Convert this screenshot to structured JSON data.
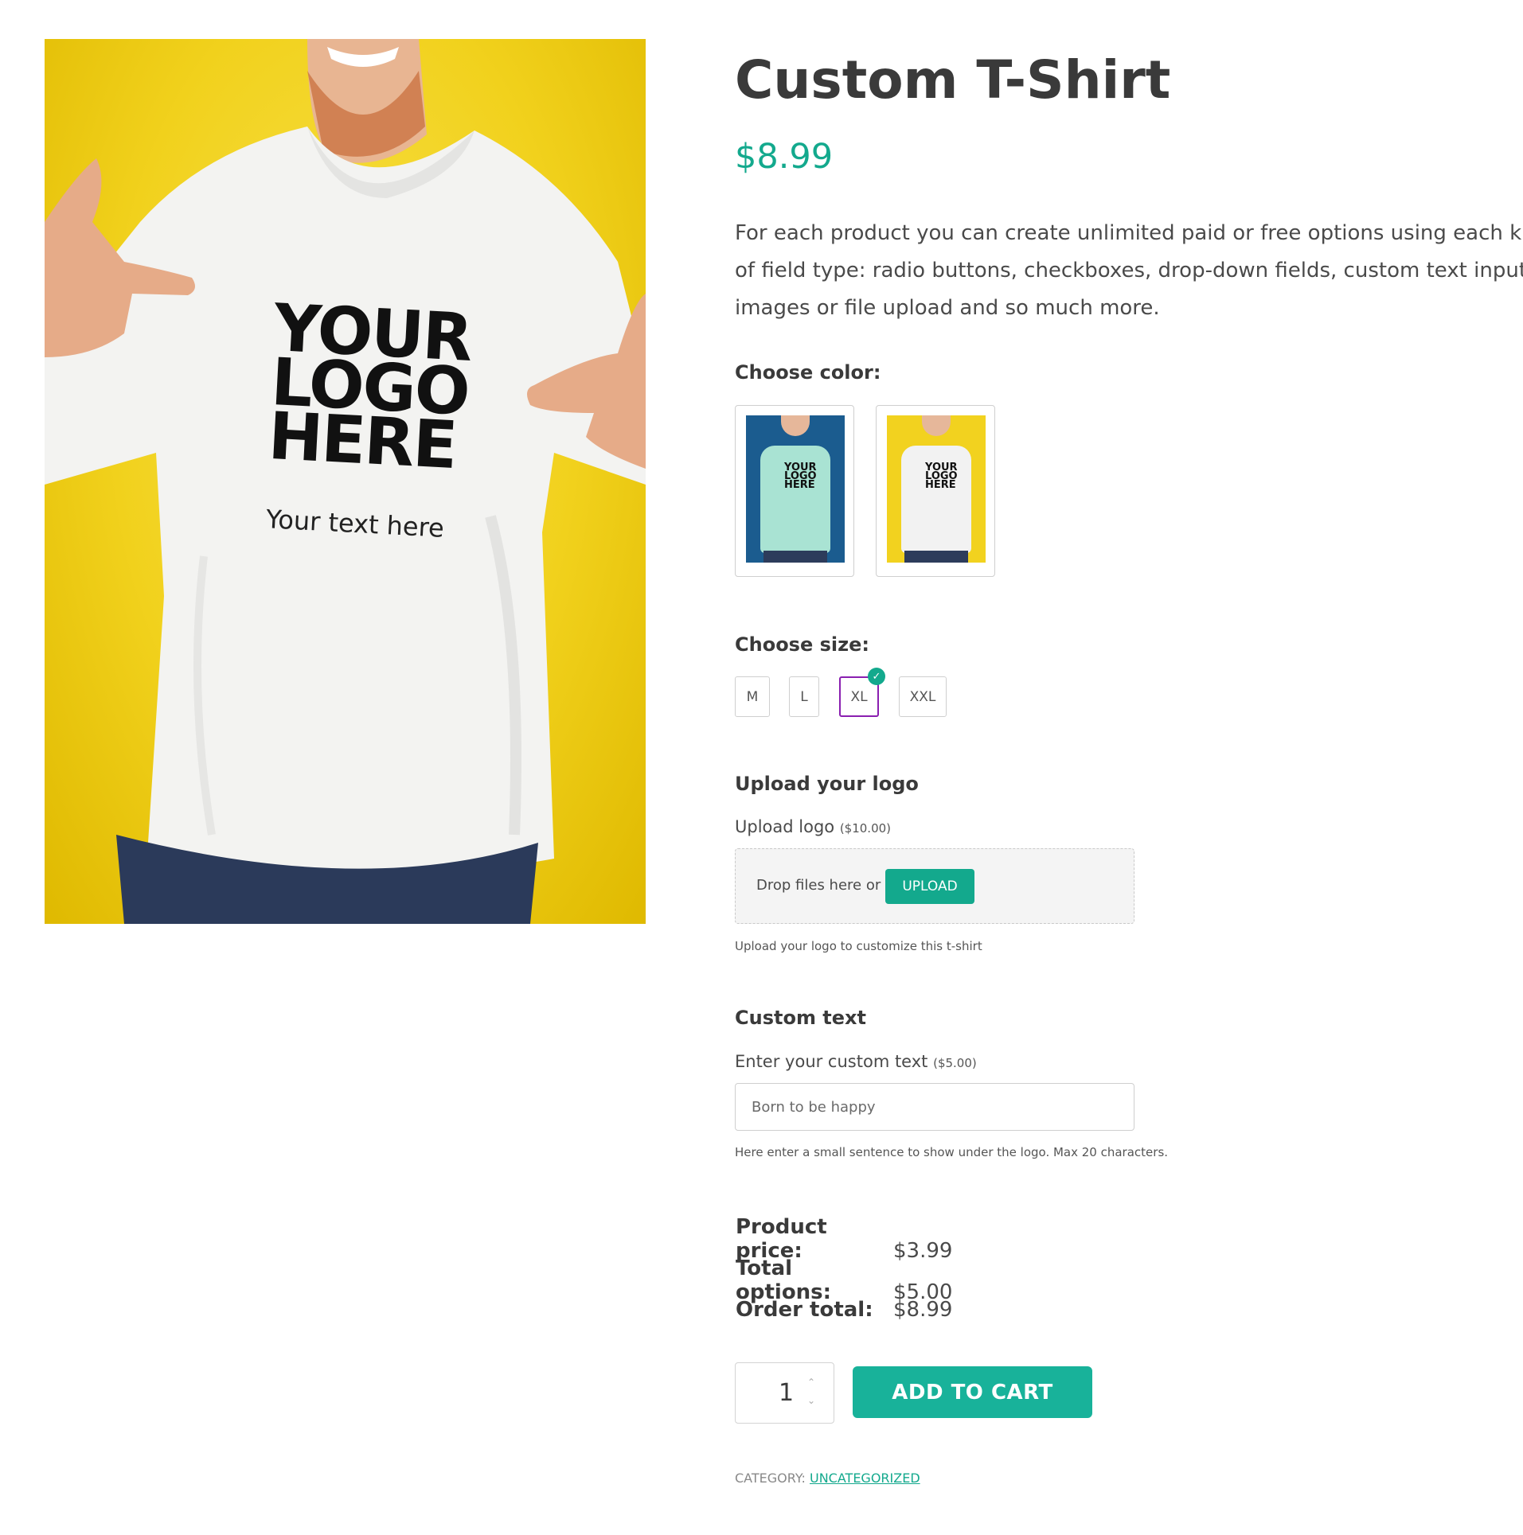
{
  "hero": {
    "logo_lines": [
      "YOUR",
      "LOGO",
      "HERE"
    ],
    "shirt_text": "Your text here"
  },
  "product": {
    "title": "Custom T-Shirt",
    "price": "$8.99",
    "description": "For each product you can create unlimited paid or free options using each kind of field type: radio buttons, checkboxes, drop-down fields, custom text inputs, images or file upload and so much more."
  },
  "color": {
    "label": "Choose color:",
    "swatches": [
      {
        "name": "mint",
        "shirt_color": "#a9e3d3",
        "bg_color": "#1b5c8f"
      },
      {
        "name": "white",
        "shirt_color": "#f2f2f2",
        "bg_color": "#f2d21f"
      }
    ],
    "mini_logo": [
      "YOUR",
      "LOGO",
      "HERE"
    ]
  },
  "size": {
    "label": "Choose size:",
    "options": [
      "M",
      "L",
      "XL",
      "XXL"
    ],
    "selected": "XL"
  },
  "logo_upload": {
    "heading": "Upload your logo",
    "field_label": "Upload logo",
    "field_price": "($10.00)",
    "drop_text": "Drop files here or",
    "button_label": "UPLOAD",
    "help": "Upload your logo to customize this t-shirt"
  },
  "custom_text": {
    "heading": "Custom text",
    "field_label": "Enter your custom text",
    "field_price": "($5.00)",
    "value": "Born to be happy",
    "help": "Here enter a small sentence to show under the logo. Max 20 characters."
  },
  "totals": [
    {
      "label": "Product price:",
      "value": "$3.99"
    },
    {
      "label": "Total options:",
      "value": "$5.00"
    },
    {
      "label": "Order total:",
      "value": "$8.99"
    }
  ],
  "cart": {
    "quantity": "1",
    "add_label": "ADD TO CART"
  },
  "category": {
    "prefix": "CATEGORY:",
    "link": "UNCATEGORIZED"
  },
  "colors": {
    "accent": "#13a98d",
    "selected_border": "#8a1fb0",
    "hero_bg": "#f1d11c"
  }
}
